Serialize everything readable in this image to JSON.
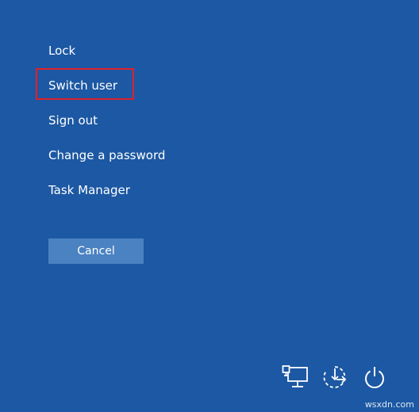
{
  "menu": {
    "items": [
      {
        "label": "Lock"
      },
      {
        "label": "Switch user"
      },
      {
        "label": "Sign out"
      },
      {
        "label": "Change a password"
      },
      {
        "label": "Task Manager"
      }
    ],
    "highlighted_item": "Switch user"
  },
  "cancel": {
    "label": "Cancel"
  },
  "tray": {
    "icons": [
      "network-icon",
      "accessibility-icon",
      "power-icon"
    ]
  },
  "colors": {
    "background": "#1c58a3",
    "button": "#4a82c2",
    "highlight_border": "#e0202c",
    "text": "#ffffff"
  },
  "watermark": "wsxdn.com"
}
